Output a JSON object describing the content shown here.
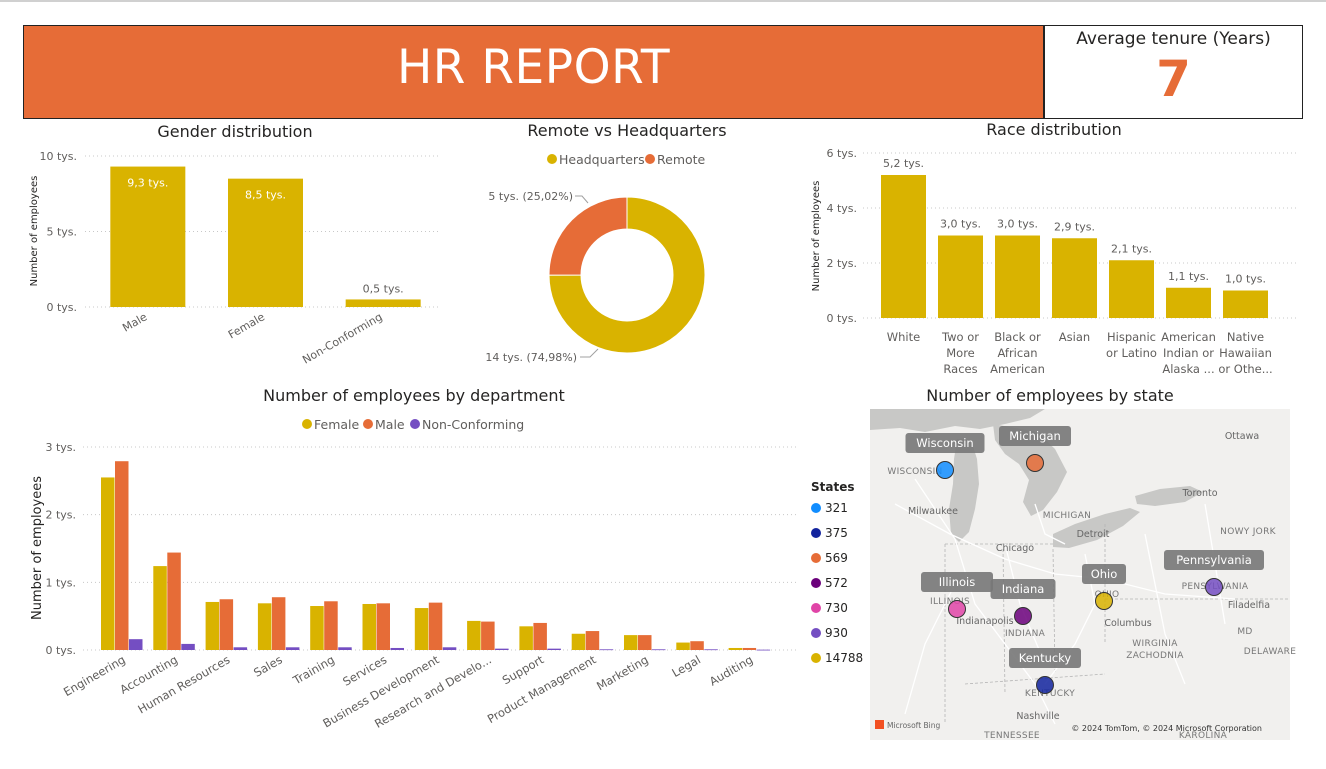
{
  "header": {
    "title": "HR REPORT"
  },
  "kpi": {
    "label": "Average tenure (Years)",
    "value": "7"
  },
  "colors": {
    "gold": "#d9b300",
    "orange": "#e66c37",
    "purple": "#744ec2",
    "banner": "#e66c37"
  },
  "chart_data": [
    {
      "id": "gender",
      "type": "bar",
      "title": "Gender distribution",
      "ylabel": "Number of employees",
      "categories": [
        "Male",
        "Female",
        "Non-Conforming"
      ],
      "values": [
        9.3,
        8.5,
        0.5
      ],
      "data_labels": [
        "9,3 tys.",
        "8,5 tys.",
        "0,5 tys."
      ],
      "yticks": [
        "0 tys.",
        "5 tys.",
        "10 tys."
      ],
      "ylim": [
        0,
        10
      ],
      "grid": true
    },
    {
      "id": "remote",
      "type": "pie",
      "title": "Remote vs Headquarters",
      "legend_position": "top",
      "slices": [
        {
          "name": "Headquarters",
          "value": 74.98,
          "label": "14 tys. (74,98%)",
          "color": "#d9b300"
        },
        {
          "name": "Remote",
          "value": 25.02,
          "label": "5 tys. (25,02%)",
          "color": "#e66c37"
        }
      ]
    },
    {
      "id": "race",
      "type": "bar",
      "title": "Race distribution",
      "ylabel": "Number of employees",
      "categories": [
        [
          "White"
        ],
        [
          "Two or",
          "More",
          "Races"
        ],
        [
          "Black or",
          "African",
          "American"
        ],
        [
          "Asian"
        ],
        [
          "Hispanic",
          "or Latino"
        ],
        [
          "American",
          "Indian or",
          "Alaska ..."
        ],
        [
          "Native",
          "Hawaiian",
          "or Othe..."
        ]
      ],
      "values": [
        5.2,
        3.0,
        3.0,
        2.9,
        2.1,
        1.1,
        1.0
      ],
      "data_labels": [
        "5,2 tys.",
        "3,0 tys.",
        "3,0 tys.",
        "2,9 tys.",
        "2,1 tys.",
        "1,1 tys.",
        "1,0 tys."
      ],
      "yticks": [
        "0 tys.",
        "2 tys.",
        "4 tys.",
        "6 tys."
      ],
      "ylim": [
        0,
        6
      ],
      "grid": true
    },
    {
      "id": "dept",
      "type": "bar",
      "title": "Number of employees by department",
      "ylabel": "Number of employees",
      "legend_position": "top",
      "categories": [
        "Engineering",
        "Accounting",
        "Human Resources",
        "Sales",
        "Training",
        "Services",
        "Business Development",
        "Research and Develo...",
        "Support",
        "Product Management",
        "Marketing",
        "Legal",
        "Auditing"
      ],
      "series": [
        {
          "name": "Female",
          "color": "#d9b300",
          "values": [
            2.55,
            1.24,
            0.71,
            0.69,
            0.65,
            0.68,
            0.62,
            0.43,
            0.35,
            0.24,
            0.22,
            0.11,
            0.03
          ]
        },
        {
          "name": "Male",
          "color": "#e66c37",
          "values": [
            2.79,
            1.44,
            0.75,
            0.78,
            0.72,
            0.69,
            0.7,
            0.42,
            0.4,
            0.28,
            0.22,
            0.13,
            0.03
          ]
        },
        {
          "name": "Non-Conforming",
          "color": "#744ec2",
          "values": [
            0.16,
            0.09,
            0.04,
            0.04,
            0.04,
            0.03,
            0.04,
            0.02,
            0.02,
            0.01,
            0.01,
            0.01,
            0.005
          ]
        }
      ],
      "yticks": [
        "0 tys.",
        "1 tys.",
        "2 tys.",
        "3 tys."
      ],
      "ylim": [
        0,
        3
      ],
      "grid": true
    },
    {
      "id": "state",
      "type": "map",
      "title": "Number of employees by state",
      "legend_title": "States",
      "legend": [
        {
          "value": "321",
          "color": "#118dff"
        },
        {
          "value": "375",
          "color": "#12239e"
        },
        {
          "value": "569",
          "color": "#e66c37"
        },
        {
          "value": "572",
          "color": "#6b007b"
        },
        {
          "value": "730",
          "color": "#e044a7"
        },
        {
          "value": "930",
          "color": "#744ec2"
        },
        {
          "value": "14788",
          "color": "#d9b300"
        }
      ],
      "states": [
        {
          "name": "Wisconsin",
          "count": 321
        },
        {
          "name": "Michigan",
          "count": 569
        },
        {
          "name": "Illinois",
          "count": 730
        },
        {
          "name": "Indiana",
          "count": 572
        },
        {
          "name": "Ohio",
          "count": 14788
        },
        {
          "name": "Pennsylvania",
          "count": 930
        },
        {
          "name": "Kentucky",
          "count": 375
        }
      ],
      "map_labels": [
        "Ottawa",
        "WISCONSIN",
        "Milwaukee",
        "MICHIGAN",
        "Detroit",
        "Chicago",
        "Toronto",
        "NOWY JORK",
        "ILLINOIS",
        "Indianapolis",
        "INDIANA",
        "OHIO",
        "Columbus",
        "PENSYLWANIA",
        "Filadelfia",
        "MD",
        "DELAWARE",
        "WIRGINIA",
        "ZACHODNIA",
        "KENTUCKY",
        "Nashville",
        "TENNESSEE",
        "KAROLINA"
      ],
      "attribution": "© 2024 TomTom, © 2024 Microsoft Corporation",
      "brand": "Microsoft Bing"
    }
  ]
}
